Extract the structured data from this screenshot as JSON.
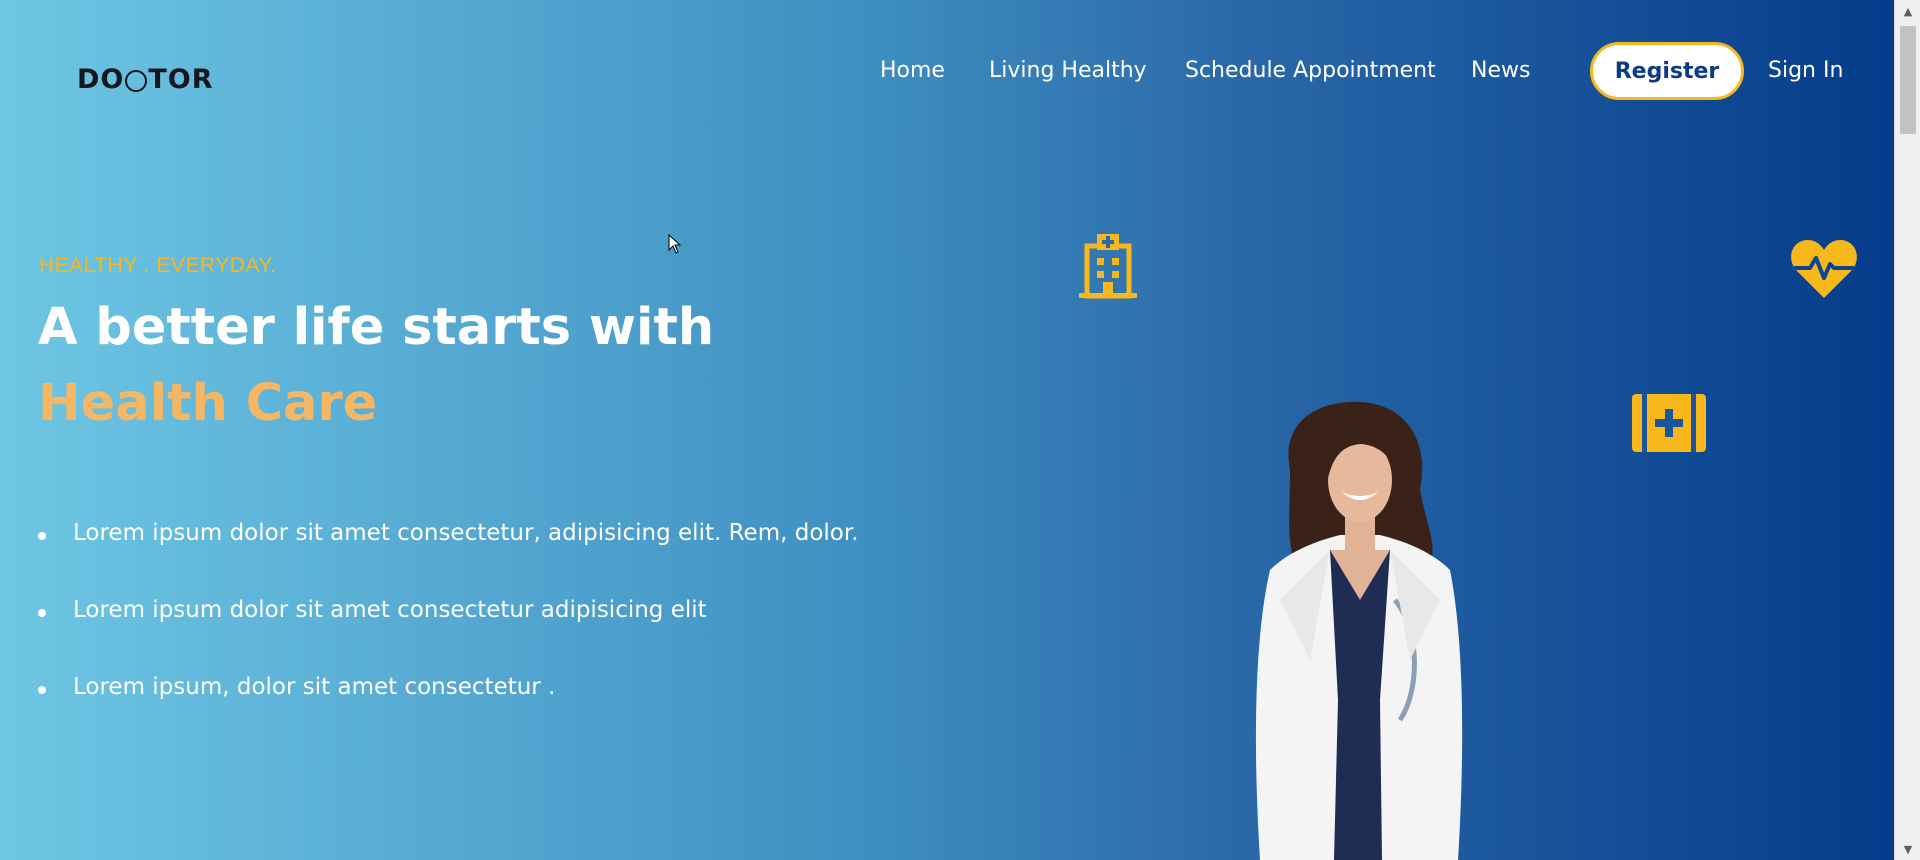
{
  "brand": {
    "logo_text_left": "DO",
    "logo_text_right": "TOR"
  },
  "nav": {
    "items": [
      {
        "label": "Home"
      },
      {
        "label": "Living Healthy"
      },
      {
        "label": "Schedule Appointment"
      },
      {
        "label": "News"
      }
    ],
    "register_label": "Register",
    "signin_label": "Sign In"
  },
  "hero": {
    "kicker": "HEALTHY . EVERYDAY.",
    "headline": "A better life starts with",
    "headline_accent": "Health Care",
    "bullets": [
      "Lorem ipsum dolor sit amet consectetur, adipisicing elit. Rem, dolor.",
      "Lorem ipsum dolor sit amet consectetur adipisicing elit",
      "Lorem ipsum, dolor sit amet consectetur ."
    ]
  },
  "icons": [
    "hospital-icon",
    "heart-pulse-icon",
    "first-aid-kit-icon"
  ],
  "colors": {
    "accent_yellow": "#f8b71b",
    "accent_orange": "#f6b764",
    "brand_navy": "#0d3a86",
    "gradient_start": "#6ec6e3",
    "gradient_end": "#033a8a"
  }
}
